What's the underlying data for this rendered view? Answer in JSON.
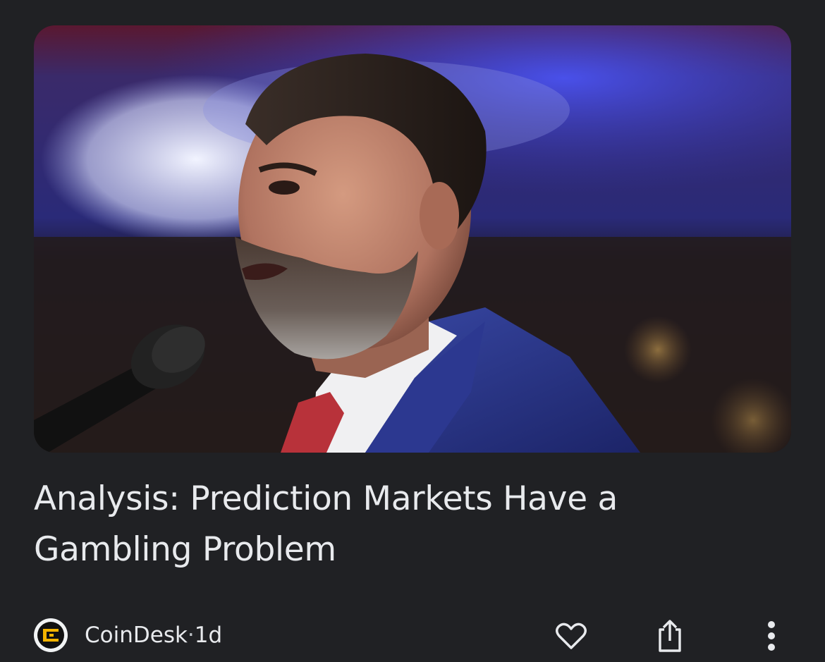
{
  "article": {
    "image_alt": "Speaker at a microphone in front of a red, white and blue backdrop",
    "headline": "Analysis: Prediction Markets Have a Gambling Problem",
    "source_name": "CoinDesk",
    "separator": " · ",
    "age": "1d"
  },
  "actions": {
    "like_icon": "heart-outline-icon",
    "share_icon": "share-icon",
    "more_icon": "more-vert-icon"
  },
  "colors": {
    "background": "#202124",
    "text": "#e8eaed",
    "icon": "#e8eaed",
    "logo_accent": "#f4b400"
  }
}
